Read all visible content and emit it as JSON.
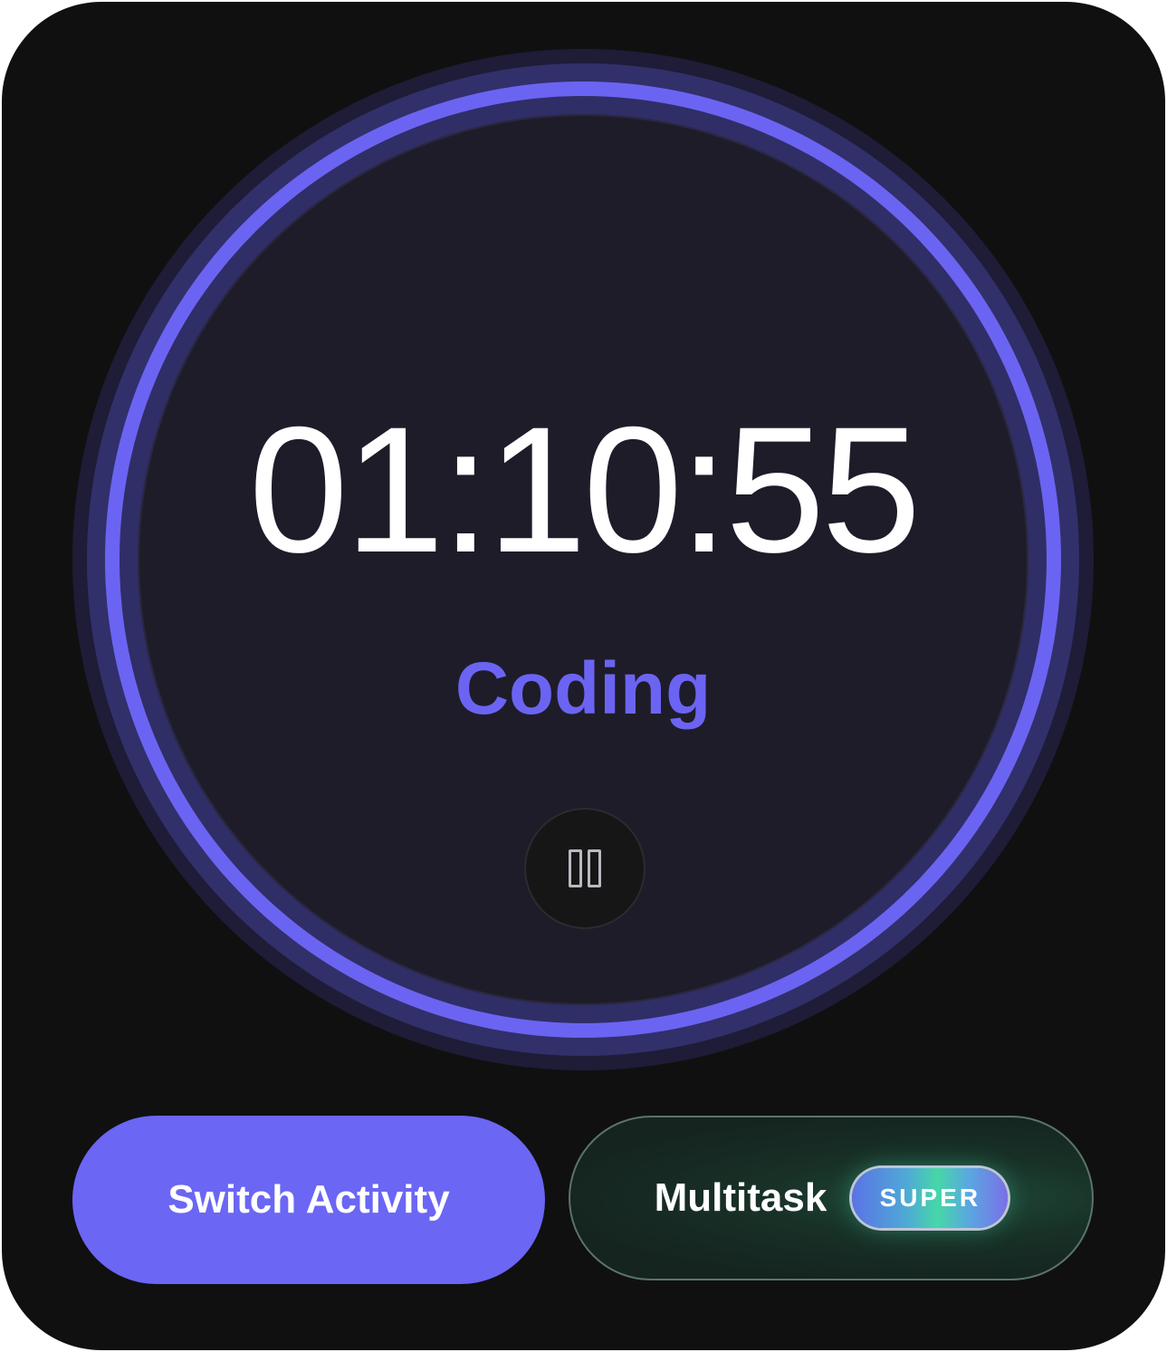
{
  "timer": {
    "time": "01:10:55",
    "activity": "Coding"
  },
  "controls": {
    "pause_icon": "pause-icon"
  },
  "actions": {
    "switch_activity_label": "Switch Activity",
    "multitask_label": "Multitask",
    "super_badge": "SUPER"
  },
  "colors": {
    "background": "#101011",
    "accent": "#6b64f2",
    "face": "#1e1c29",
    "multitask_bg": "#15241f"
  }
}
